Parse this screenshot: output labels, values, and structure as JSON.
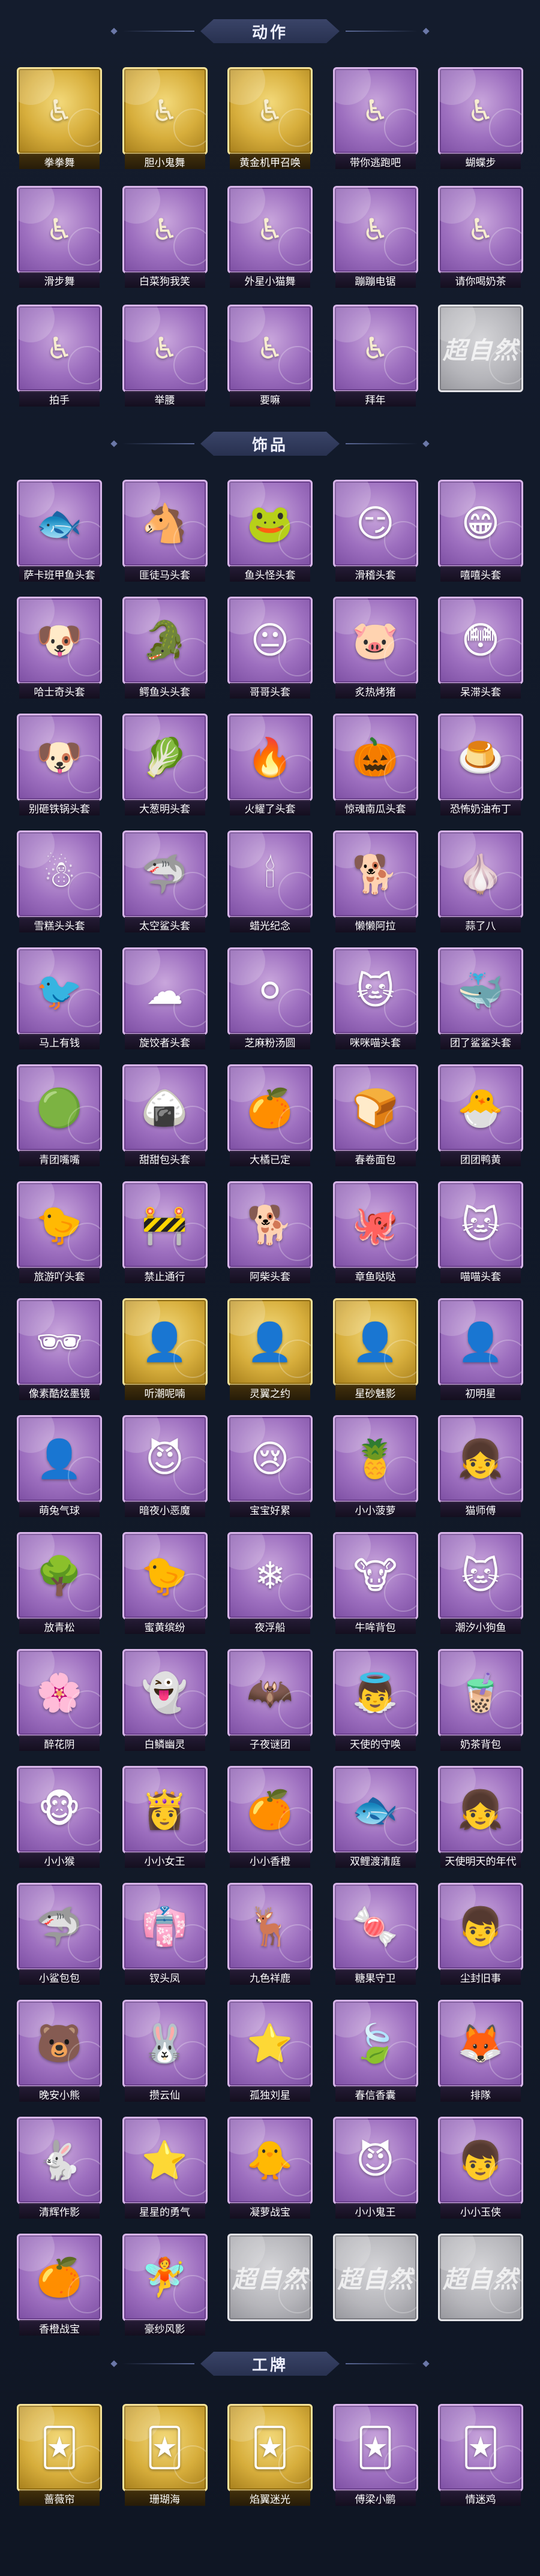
{
  "sections": [
    {
      "title": "动作",
      "items": [
        {
          "label": "拳拳舞",
          "frame": "gold",
          "icon": "♿"
        },
        {
          "label": "胆小鬼舞",
          "frame": "gold",
          "icon": "♿"
        },
        {
          "label": "黄金机甲召唤",
          "frame": "gold",
          "icon": "♿"
        },
        {
          "label": "带你逃跑吧",
          "frame": "purple",
          "icon": "♿"
        },
        {
          "label": "蝴蝶步",
          "frame": "purple",
          "icon": "♿"
        },
        {
          "label": "滑步舞",
          "frame": "purple",
          "icon": "♿"
        },
        {
          "label": "白菜狗我笑",
          "frame": "purple",
          "icon": "♿"
        },
        {
          "label": "外星小猫舞",
          "frame": "purple",
          "icon": "♿"
        },
        {
          "label": "蹦蹦电锯",
          "frame": "purple",
          "icon": "♿"
        },
        {
          "label": "请你喝奶茶",
          "frame": "purple",
          "icon": "♿"
        },
        {
          "label": "拍手",
          "frame": "purple",
          "icon": "♿"
        },
        {
          "label": "举腰",
          "frame": "purple",
          "icon": "♿"
        },
        {
          "label": "要嘛",
          "frame": "purple",
          "icon": "♿"
        },
        {
          "label": "拜年",
          "frame": "purple",
          "icon": "♿"
        },
        {
          "label": "",
          "frame": "gray",
          "icon": "",
          "watermark": "超自然"
        }
      ]
    },
    {
      "title": "饰品",
      "items": [
        {
          "label": "萨卡班甲鱼头套",
          "frame": "purple",
          "icon": "🐟"
        },
        {
          "label": "匪徒马头套",
          "frame": "purple",
          "icon": "🐴"
        },
        {
          "label": "鱼头怪头套",
          "frame": "purple",
          "icon": "🐸"
        },
        {
          "label": "滑稽头套",
          "frame": "purple",
          "icon": "😏"
        },
        {
          "label": "嘻嘻头套",
          "frame": "purple",
          "icon": "😁"
        },
        {
          "label": "哈士奇头套",
          "frame": "purple",
          "icon": "🐶"
        },
        {
          "label": "鳄鱼头头套",
          "frame": "purple",
          "icon": "🐊"
        },
        {
          "label": "哥哥头套",
          "frame": "purple",
          "icon": "😐"
        },
        {
          "label": "炙热烤猪",
          "frame": "purple",
          "icon": "🐷"
        },
        {
          "label": "呆滞头套",
          "frame": "purple",
          "icon": "😳"
        },
        {
          "label": "别砸铁锅头套",
          "frame": "purple",
          "icon": "🐶"
        },
        {
          "label": "大葱明头套",
          "frame": "purple",
          "icon": "🥬"
        },
        {
          "label": "火耀了头套",
          "frame": "purple",
          "icon": "🔥"
        },
        {
          "label": "惊魂南瓜头套",
          "frame": "purple",
          "icon": "🎃"
        },
        {
          "label": "恐怖奶油布丁",
          "frame": "purple",
          "icon": "🍮"
        },
        {
          "label": "雪糕头头套",
          "frame": "purple",
          "icon": "☃"
        },
        {
          "label": "太空鲨头套",
          "frame": "purple",
          "icon": "🦈"
        },
        {
          "label": "蜡光纪念",
          "frame": "purple",
          "icon": "🕯"
        },
        {
          "label": "懒懒阿拉",
          "frame": "purple",
          "icon": "🐕"
        },
        {
          "label": "蒜了八",
          "frame": "purple",
          "icon": "🧄"
        },
        {
          "label": "马上有钱",
          "frame": "purple",
          "icon": "🐦"
        },
        {
          "label": "旋饺者头套",
          "frame": "purple",
          "icon": "☁"
        },
        {
          "label": "芝麻粉汤圆",
          "frame": "purple",
          "icon": "⚪"
        },
        {
          "label": "咪咪喵头套",
          "frame": "purple",
          "icon": "🐱"
        },
        {
          "label": "团了鲨鲨头套",
          "frame": "purple",
          "icon": "🐳"
        },
        {
          "label": "青团嘴嘴",
          "frame": "purple",
          "icon": "🟢"
        },
        {
          "label": "甜甜包头套",
          "frame": "purple",
          "icon": "🍙"
        },
        {
          "label": "大橘已定",
          "frame": "purple",
          "icon": "🍊"
        },
        {
          "label": "春卷面包",
          "frame": "purple",
          "icon": "🍞"
        },
        {
          "label": "团团鸭黄",
          "frame": "purple",
          "icon": "🐣"
        },
        {
          "label": "旅游吖头套",
          "frame": "purple",
          "icon": "🐤"
        },
        {
          "label": "禁止通行",
          "frame": "purple",
          "icon": "🚧"
        },
        {
          "label": "阿柴头套",
          "frame": "purple",
          "icon": "🐕"
        },
        {
          "label": "章鱼哒哒",
          "frame": "purple",
          "icon": "🐙"
        },
        {
          "label": "喵喵头套",
          "frame": "purple",
          "icon": "🐱"
        },
        {
          "label": "像素酷炫墨镜",
          "frame": "purple",
          "icon": "🕶"
        },
        {
          "label": "听潮呢喃",
          "frame": "gold",
          "icon": "👤"
        },
        {
          "label": "灵翼之约",
          "frame": "gold",
          "icon": "👤"
        },
        {
          "label": "星砂魅影",
          "frame": "gold",
          "icon": "👤"
        },
        {
          "label": "初明星",
          "frame": "purple",
          "icon": "👤"
        },
        {
          "label": "萌兔气球",
          "frame": "purple",
          "icon": "👤"
        },
        {
          "label": "暗夜小恶魔",
          "frame": "purple",
          "icon": "😈"
        },
        {
          "label": "宝宝好累",
          "frame": "purple",
          "icon": "😢"
        },
        {
          "label": "小小菠萝",
          "frame": "purple",
          "icon": "🍍"
        },
        {
          "label": "猫师傅",
          "frame": "purple",
          "icon": "👧"
        },
        {
          "label": "放青松",
          "frame": "purple",
          "icon": "🌳"
        },
        {
          "label": "蜜黄缤纷",
          "frame": "purple",
          "icon": "🐤"
        },
        {
          "label": "夜浮船",
          "frame": "purple",
          "icon": "❄"
        },
        {
          "label": "牛哞背包",
          "frame": "purple",
          "icon": "🐮"
        },
        {
          "label": "潮汐小狗鱼",
          "frame": "purple",
          "icon": "🐱"
        },
        {
          "label": "醉花阴",
          "frame": "purple",
          "icon": "🌸"
        },
        {
          "label": "白鳞幽灵",
          "frame": "purple",
          "icon": "👻"
        },
        {
          "label": "子夜谜团",
          "frame": "purple",
          "icon": "🦇"
        },
        {
          "label": "天使的守唤",
          "frame": "purple",
          "icon": "👼"
        },
        {
          "label": "奶茶背包",
          "frame": "purple",
          "icon": "🧋"
        },
        {
          "label": "小小猴",
          "frame": "purple",
          "icon": "🐵"
        },
        {
          "label": "小小女王",
          "frame": "purple",
          "icon": "👸"
        },
        {
          "label": "小小香橙",
          "frame": "purple",
          "icon": "🍊"
        },
        {
          "label": "双鲤渡清庭",
          "frame": "purple",
          "icon": "🐟"
        },
        {
          "label": "天使明天的年代",
          "frame": "purple",
          "icon": "👧"
        },
        {
          "label": "小鲨包包",
          "frame": "purple",
          "icon": "🦈"
        },
        {
          "label": "钗头凤",
          "frame": "purple",
          "icon": "👘"
        },
        {
          "label": "九色祥鹿",
          "frame": "purple",
          "icon": "🦌"
        },
        {
          "label": "糖果守卫",
          "frame": "purple",
          "icon": "🍬"
        },
        {
          "label": "尘封旧事",
          "frame": "purple",
          "icon": "👦"
        },
        {
          "label": "晚安小熊",
          "frame": "purple",
          "icon": "🐻"
        },
        {
          "label": "攒云仙",
          "frame": "purple",
          "icon": "🐰"
        },
        {
          "label": "孤独刘星",
          "frame": "purple",
          "icon": "⭐"
        },
        {
          "label": "春信香囊",
          "frame": "purple",
          "icon": "🍃"
        },
        {
          "label": "排隊",
          "frame": "purple",
          "icon": "🦊"
        },
        {
          "label": "清辉作影",
          "frame": "purple",
          "icon": "🐇"
        },
        {
          "label": "星星的勇气",
          "frame": "purple",
          "icon": "⭐"
        },
        {
          "label": "凝萝战宝",
          "frame": "purple",
          "icon": "🐥"
        },
        {
          "label": "小小鬼王",
          "frame": "purple",
          "icon": "😈"
        },
        {
          "label": "小小玉侠",
          "frame": "purple",
          "icon": "👦"
        },
        {
          "label": "香橙战宝",
          "frame": "purple",
          "icon": "🍊"
        },
        {
          "label": "豪纱风影",
          "frame": "purple",
          "icon": "🧚"
        },
        {
          "label": "",
          "frame": "gray",
          "icon": "",
          "watermark": "超自然"
        },
        {
          "label": "",
          "frame": "gray",
          "icon": "",
          "watermark": "超自然"
        },
        {
          "label": "",
          "frame": "gray",
          "icon": "",
          "watermark": "超自然"
        }
      ]
    },
    {
      "title": "工牌",
      "items": [
        {
          "label": "蔷薇帘",
          "frame": "gold",
          "icon": "🃏"
        },
        {
          "label": "珊瑚海",
          "frame": "gold",
          "icon": "🃏"
        },
        {
          "label": "焰翼迷光",
          "frame": "gold",
          "icon": "🃏"
        },
        {
          "label": "傅梁小鹏",
          "frame": "purple",
          "icon": "🃏"
        },
        {
          "label": "情迷鸡",
          "frame": "purple",
          "icon": "🃏"
        }
      ]
    }
  ]
}
